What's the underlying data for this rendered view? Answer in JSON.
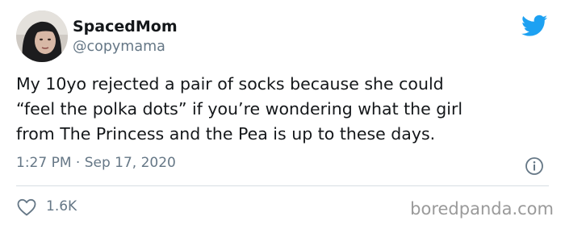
{
  "author": {
    "display_name": "SpacedMom",
    "handle": "@copymama",
    "avatar_icon": "profile-photo"
  },
  "brand": {
    "icon": "twitter-bird-icon",
    "color": "#1da1f2"
  },
  "tweet": {
    "lines": [
      "My 10yo rejected a pair of socks because she could",
      "“feel the polka dots” if you’re wondering what the girl",
      "from The Princess and the Pea is up to these days."
    ],
    "timestamp": "1:27 PM · Sep 17, 2020"
  },
  "actions": {
    "like_icon": "heart-outline-icon",
    "like_count": "1.6K",
    "info_icon": "info-icon"
  },
  "watermark": "boredpanda.com",
  "colors": {
    "text": "#14171a",
    "secondary": "#657786",
    "divider": "#d6dde3"
  }
}
